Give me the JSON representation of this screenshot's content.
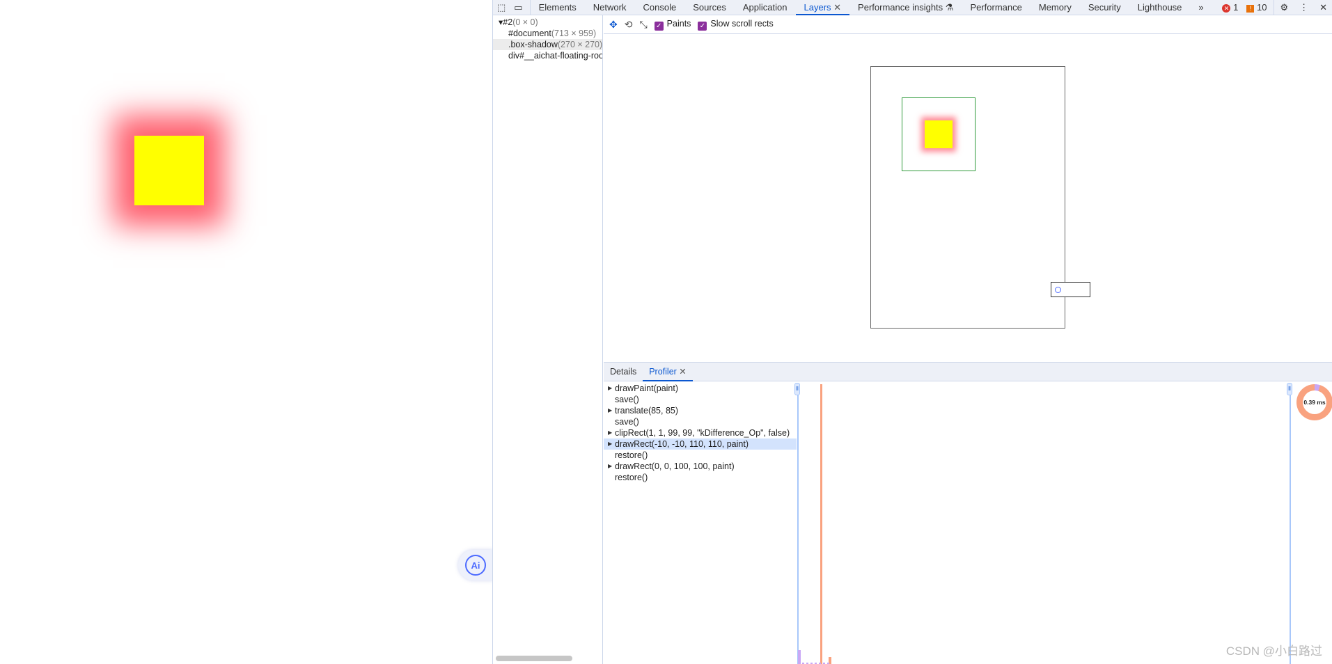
{
  "page": {
    "ai_button_label": "Ai"
  },
  "devtools": {
    "tabs": [
      {
        "label": "Elements"
      },
      {
        "label": "Network"
      },
      {
        "label": "Console"
      },
      {
        "label": "Sources"
      },
      {
        "label": "Application"
      },
      {
        "label": "Layers",
        "active": true,
        "closable": true
      },
      {
        "label": "Performance insights",
        "icon": "flask-icon"
      },
      {
        "label": "Performance"
      },
      {
        "label": "Memory"
      },
      {
        "label": "Security"
      },
      {
        "label": "Lighthouse"
      }
    ],
    "errors_count": "1",
    "warnings_count": "10",
    "layer_tree": [
      {
        "name": "▾#2",
        "dims": "(0 × 0)"
      },
      {
        "name": "#document",
        "dims": "(713 × 959)"
      },
      {
        "name": ".box-shadow",
        "dims": "(270 × 270)",
        "selected": true
      },
      {
        "name": "div#__aichat-floating-root",
        "dims": ""
      }
    ],
    "toolbar": {
      "paints_label": "Paints",
      "paints_checked": true,
      "slow_scroll_label": "Slow scroll rects",
      "slow_scroll_checked": true
    },
    "bottom_tabs": [
      {
        "label": "Details"
      },
      {
        "label": "Profiler",
        "active": true
      }
    ],
    "commands": [
      {
        "text": "drawPaint(paint)",
        "expandable": true
      },
      {
        "text": "save()"
      },
      {
        "text": "translate(85, 85)",
        "expandable": true
      },
      {
        "text": "save()"
      },
      {
        "text": "clipRect(1, 1, 99, 99, \"kDifference_Op\", false)",
        "expandable": true
      },
      {
        "text": "drawRect(-10, -10, 110, 110, paint)",
        "expandable": true,
        "selected": true
      },
      {
        "text": "restore()"
      },
      {
        "text": "drawRect(0, 0, 100, 100, paint)",
        "expandable": true
      },
      {
        "text": "restore()"
      }
    ],
    "profiler_total": "0.39 ms",
    "colors": {
      "accent": "#0b57d0",
      "paint_bar": "#f9a27f",
      "other_bar": "#c9a7f5"
    }
  },
  "watermark": "CSDN @小白路过"
}
